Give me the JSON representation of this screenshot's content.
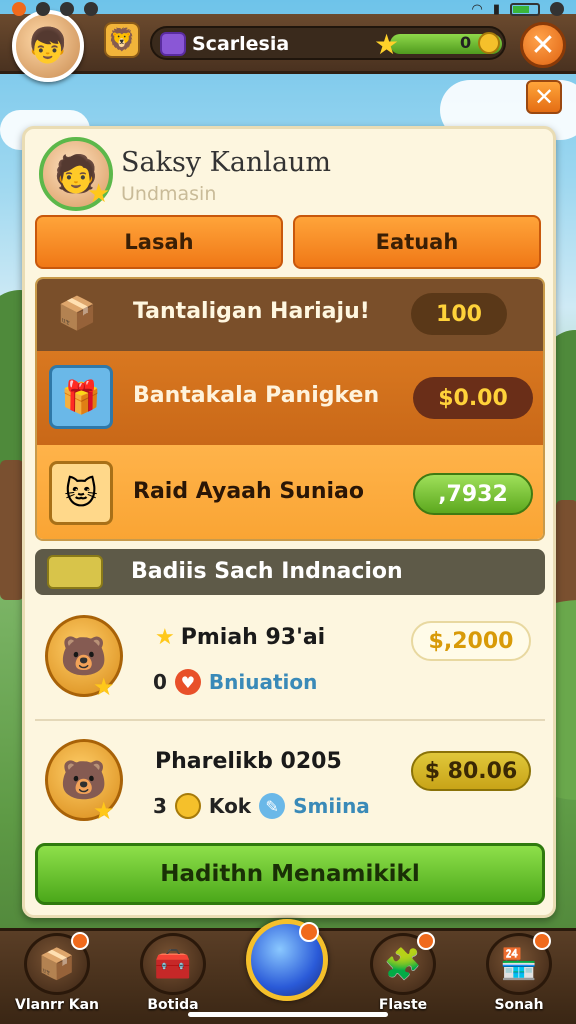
{
  "header": {
    "player_name": "Scarlesia",
    "xp_value": "0"
  },
  "profile": {
    "name": "Saksy Kanlaum",
    "subtitle": "Undmasin"
  },
  "tabs": [
    {
      "label": "Lasah"
    },
    {
      "label": "Eatuah"
    }
  ],
  "rewards": [
    {
      "label": "Tantaligan Hariaju!",
      "value": "100",
      "icon": "chest-icon"
    },
    {
      "label": "Bantakala Panigken",
      "value": "$0.00",
      "icon": "purple-box-icon"
    },
    {
      "label": "Raid Ayaah Suniao",
      "value": ",7932",
      "icon": "cat-character-icon"
    }
  ],
  "section": {
    "title": "Badiis Sach Indnacion"
  },
  "items": [
    {
      "title": "Pmiah 93'ai",
      "price": "$,2000",
      "meta_count": "0",
      "meta_label": "Bniuation"
    },
    {
      "title": "Pharelikb 0205",
      "price": "$ 80.06",
      "meta_count": "3",
      "meta_label_1": "Kok",
      "meta_label_2": "Smiina"
    }
  ],
  "primary_button": {
    "label": "Hadithn Menamikikl"
  },
  "bottom_nav": [
    {
      "label": "Vlanrr Kan",
      "icon": "box-icon"
    },
    {
      "label": "Botida",
      "icon": "chest-icon"
    },
    {
      "label": "",
      "icon": "orb-icon"
    },
    {
      "label": "Flaste",
      "icon": "puzzle-icon"
    },
    {
      "label": "Sonah",
      "icon": "shop-icon"
    }
  ],
  "colors": {
    "accent_orange": "#f07816",
    "primary_green": "#4ba81a",
    "panel_bg": "#fdf6df",
    "coin_gold": "#f5c02b"
  }
}
